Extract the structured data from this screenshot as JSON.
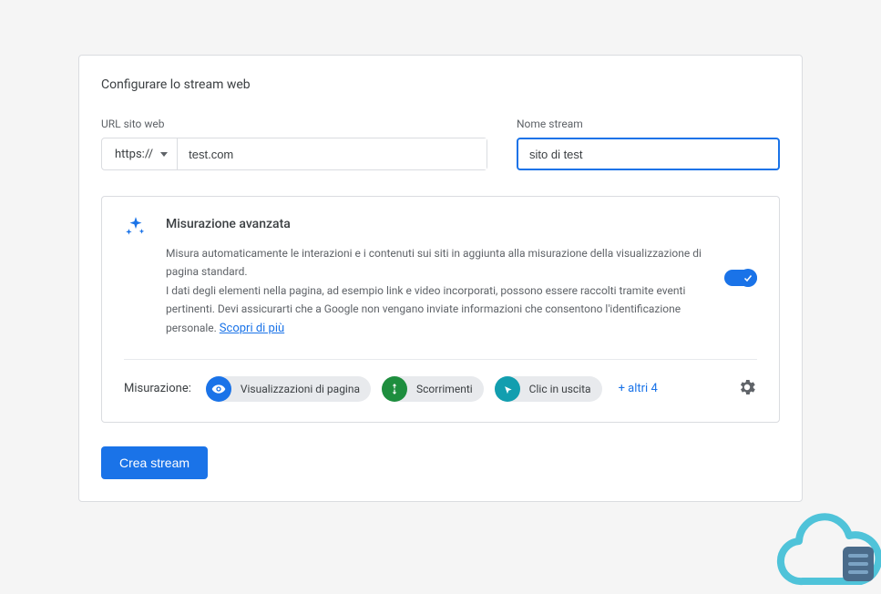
{
  "card": {
    "title": "Configurare lo stream web"
  },
  "fields": {
    "url_label": "URL sito web",
    "protocol": "https://",
    "url_value": "test.com",
    "name_label": "Nome stream",
    "name_value": "sito di test"
  },
  "panel": {
    "title": "Misurazione avanzata",
    "desc1": "Misura automaticamente le interazioni e i contenuti sui siti in aggiunta alla misurazione della visualizzazione di pagina standard.",
    "desc2": "I dati degli elementi nella pagina, ad esempio link e video incorporati, possono essere raccolti tramite eventi pertinenti. Devi assicurarti che a Google non vengano inviate informazioni che consentono l'identificazione personale.",
    "learn_more": "Scopri di più",
    "measure_label": "Misurazione:",
    "chips": {
      "pageview": "Visualizzazioni di pagina",
      "scroll": "Scorrimenti",
      "outbound": "Clic in uscita"
    },
    "more_link": "+ altri 4"
  },
  "actions": {
    "create": "Crea stream"
  },
  "colors": {
    "primary": "#1a73e8",
    "green": "#1e8e3e",
    "teal": "#129eaf"
  }
}
